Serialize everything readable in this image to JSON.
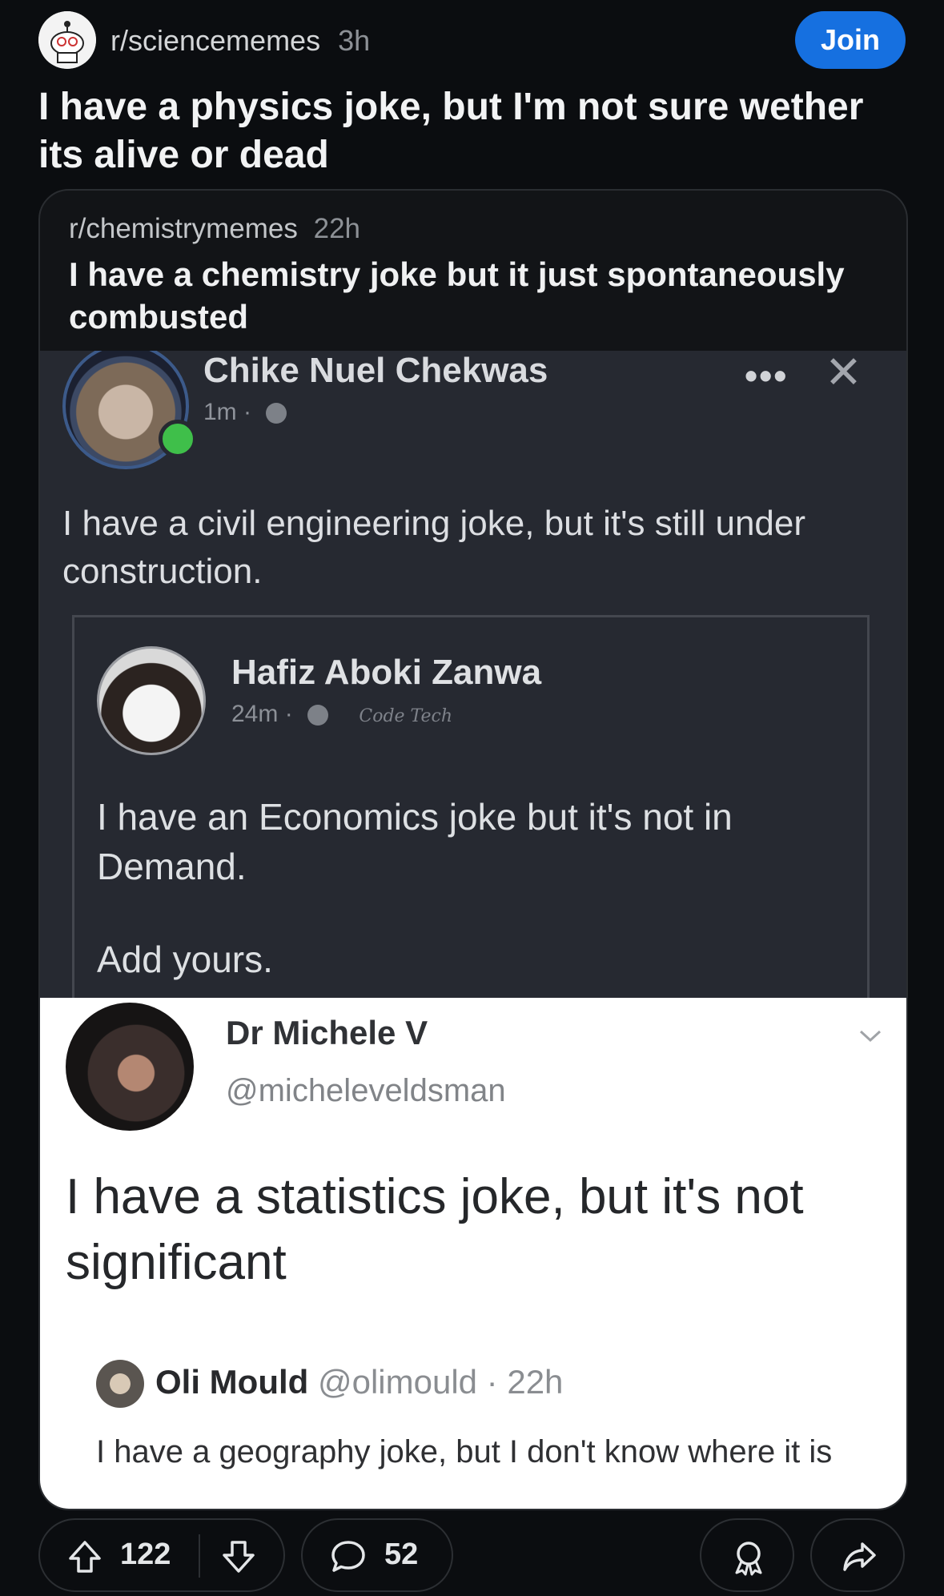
{
  "post": {
    "subreddit": "r/sciencememes",
    "age": "3h",
    "join_label": "Join",
    "title": "I have a physics joke, but I'm not sure wether its alive or dead"
  },
  "crosspost": {
    "subreddit": "r/chemistrymemes",
    "age": "22h",
    "title": "I have a chemistry joke but it just spontaneously combusted"
  },
  "image": {
    "fb_post": {
      "author": "Chike Nuel Chekwas",
      "time": "1m ·",
      "text": "I have a civil engineering joke, but it's still under construction.",
      "more_icon": "•••",
      "close_icon": "✕"
    },
    "fb_shared": {
      "author": "Hafiz Aboki Zanwa",
      "time": "24m ·",
      "signature": "Code Tech",
      "text": "I have an Economics joke but it's not in Demand.",
      "add_text": "Add yours."
    },
    "tweet": {
      "author": "Dr Michele V",
      "handle": "@micheleveldsman",
      "text": "I have a statistics joke, but it's not significant"
    },
    "reply": {
      "author": "Oli Mould",
      "handle_time": "@olimould · 22h",
      "text": "I have a geography joke, but I don't know where it is"
    }
  },
  "actions": {
    "upvotes": "122",
    "comments": "52"
  },
  "colors": {
    "background": "#0b0d10",
    "join": "#1670e0",
    "card": "#121417"
  }
}
